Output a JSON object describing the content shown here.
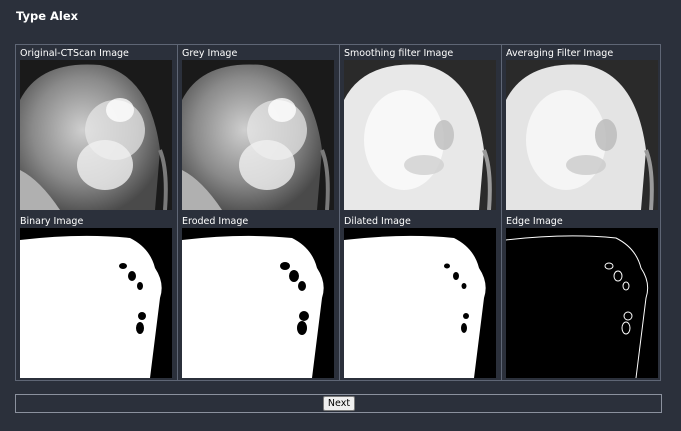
{
  "page": {
    "title": "Type Alex"
  },
  "panels": [
    {
      "label": "Original-CTScan Image",
      "style": "original"
    },
    {
      "label": "Grey Image",
      "style": "original"
    },
    {
      "label": "Smoothing filter Image",
      "style": "smooth"
    },
    {
      "label": "Averaging Filter Image",
      "style": "smooth"
    },
    {
      "label": "Binary Image",
      "style": "binary"
    },
    {
      "label": "Eroded Image",
      "style": "binary"
    },
    {
      "label": "Dilated Image",
      "style": "binary"
    },
    {
      "label": "Edge Image",
      "style": "edge"
    }
  ],
  "actions": {
    "next_label": "Next"
  },
  "colors": {
    "background": "#2b303b",
    "border": "#5f6675"
  }
}
